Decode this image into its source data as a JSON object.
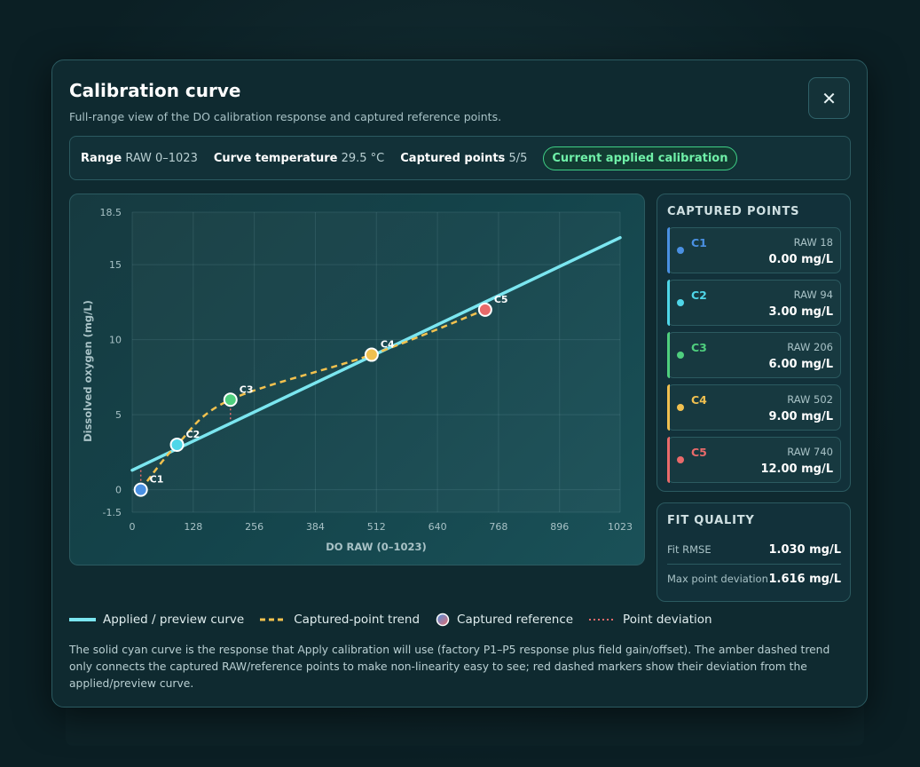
{
  "modal": {
    "title": "Calibration curve",
    "subtitle": "Full-range view of the DO calibration response and captured reference points.",
    "close_icon": "close-icon"
  },
  "info": {
    "range_label": "Range",
    "range_value": "RAW 0–1023",
    "temp_label": "Curve temperature",
    "temp_value": "29.5 °C",
    "captured_label": "Captured points",
    "captured_value": "5/5",
    "badge": "Current applied calibration"
  },
  "side": {
    "heading": "CAPTURED POINTS",
    "points": [
      {
        "label": "C1",
        "raw": "RAW 18",
        "value": "0.00 mg/L",
        "color": "#4a90e2"
      },
      {
        "label": "C2",
        "raw": "RAW 94",
        "value": "3.00 mg/L",
        "color": "#4fd6e8"
      },
      {
        "label": "C3",
        "raw": "RAW 206",
        "value": "6.00 mg/L",
        "color": "#4fcf7e"
      },
      {
        "label": "C4",
        "raw": "RAW 502",
        "value": "9.00 mg/L",
        "color": "#f0c050"
      },
      {
        "label": "C5",
        "raw": "RAW 740",
        "value": "12.00 mg/L",
        "color": "#e96a6a"
      }
    ]
  },
  "fit": {
    "heading": "FIT QUALITY",
    "rmse_label": "Fit RMSE",
    "rmse_value": "1.030 mg/L",
    "maxdev_label": "Max point deviation",
    "maxdev_value": "1.616 mg/L"
  },
  "legend": {
    "applied": "Applied / preview curve",
    "trend": "Captured-point trend",
    "reference": "Captured reference",
    "deviation": "Point deviation"
  },
  "note": "The solid cyan curve is the response that Apply calibration will use (factory P1–P5 response plus field gain/offset). The amber dashed trend only connects the captured RAW/reference points to make non-linearity easy to see; red dashed markers show their deviation from the applied/preview curve.",
  "chart_data": {
    "type": "line",
    "xlabel": "DO RAW (0–1023)",
    "ylabel": "Dissolved oxygen (mg/L)",
    "xlim": [
      0,
      1023
    ],
    "ylim": [
      -1.5,
      18.5
    ],
    "x_ticks": [
      "0",
      "128",
      "256",
      "384",
      "512",
      "640",
      "768",
      "896",
      "1023"
    ],
    "y_ticks": [
      "18.5",
      "15",
      "10",
      "5",
      "0",
      "-1.5"
    ],
    "grid": true,
    "series": [
      {
        "name": "Applied / preview curve",
        "x": [
          0,
          1023
        ],
        "y": [
          1.3,
          16.8
        ],
        "color": "#7be6f0"
      },
      {
        "name": "Captured-point trend",
        "x": [
          18,
          94,
          206,
          502,
          740
        ],
        "y": [
          0,
          3,
          6,
          9,
          12
        ],
        "color": "#f2c14e"
      }
    ],
    "points": [
      {
        "label": "C1",
        "x": 18,
        "y": 0,
        "color": "#4a90e2"
      },
      {
        "label": "C2",
        "x": 94,
        "y": 3,
        "color": "#4fd6e8"
      },
      {
        "label": "C3",
        "x": 206,
        "y": 6,
        "color": "#4fcf7e"
      },
      {
        "label": "C4",
        "x": 502,
        "y": 9,
        "color": "#f0c050"
      },
      {
        "label": "C5",
        "x": 740,
        "y": 12,
        "color": "#e96a6a"
      }
    ]
  }
}
